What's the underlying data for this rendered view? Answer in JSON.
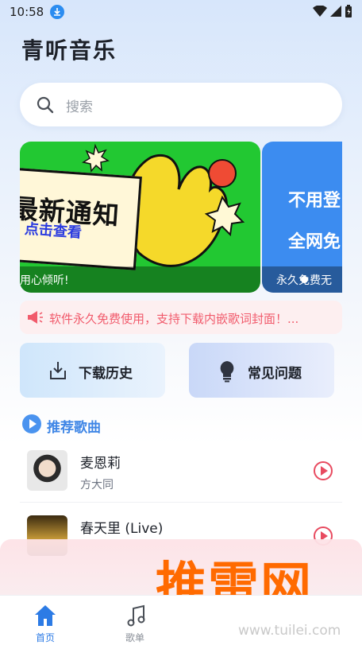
{
  "status_bar": {
    "time": "10:58"
  },
  "app": {
    "title": "青听音乐"
  },
  "search": {
    "placeholder": "搜索"
  },
  "banners": [
    {
      "title": "最新通知",
      "subtitle": "点击查看",
      "caption": "用心倾听!"
    },
    {
      "line1": "不用登",
      "line2": "全网免",
      "caption": "永久免费无"
    }
  ],
  "notice": {
    "text": "软件永久免费使用，支持下载内嵌歌词封面！..."
  },
  "quick_actions": {
    "download_history": "下载历史",
    "faq": "常见问题"
  },
  "section": {
    "title": "推荐歌曲"
  },
  "songs": [
    {
      "title": "麦恩莉",
      "artist": "方大同"
    },
    {
      "title": "春天里 (Live)",
      "artist": ""
    }
  ],
  "tabs": {
    "home": "首页",
    "playlist": "歌单"
  },
  "watermark": {
    "text": "推雷网",
    "url": "www.tuilei.com"
  },
  "colors": {
    "accent": "#3f86e6",
    "play": "#e84a5f",
    "notice": "#f15b6c",
    "watermark": "#ff6a00"
  }
}
